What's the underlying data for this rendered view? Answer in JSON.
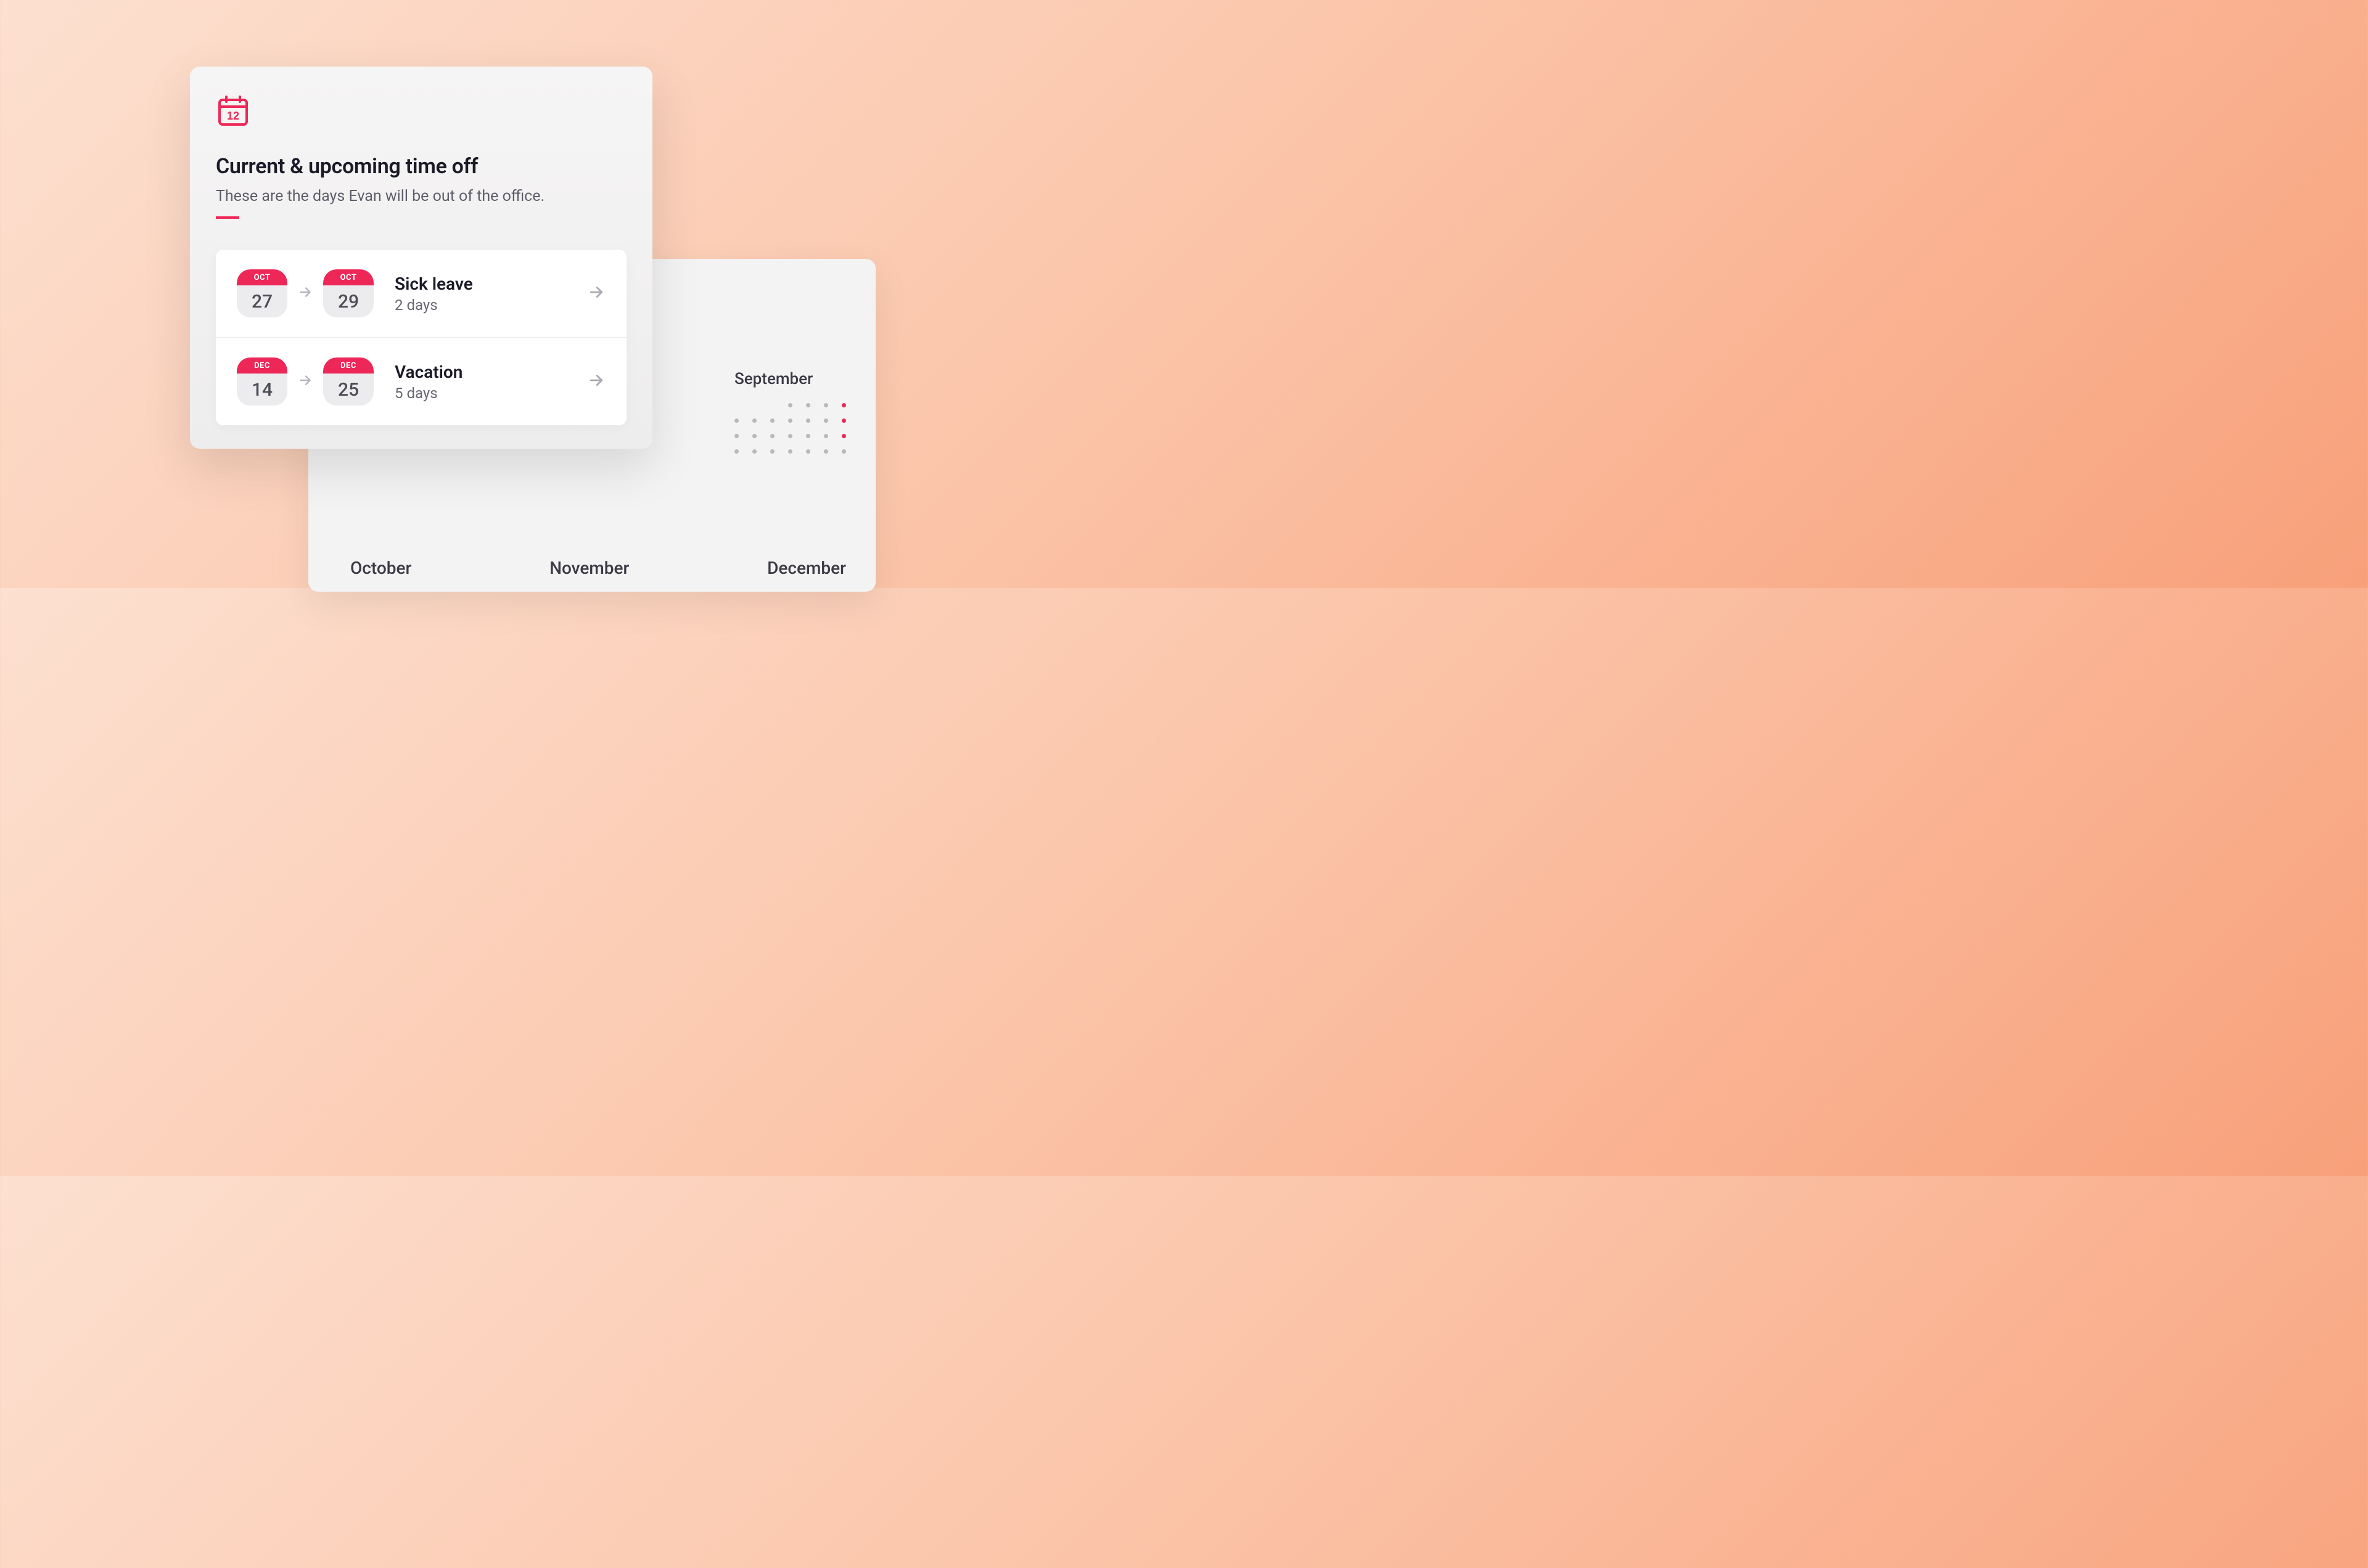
{
  "card": {
    "title": "Current & upcoming time off",
    "subtitle": "These are the days Evan will be out of the office."
  },
  "entries": [
    {
      "start_month": "OCT",
      "start_day": "27",
      "end_month": "OCT",
      "end_day": "29",
      "title": "Sick leave",
      "duration": "2 days"
    },
    {
      "start_month": "DEC",
      "start_day": "14",
      "end_month": "DEC",
      "end_day": "25",
      "title": "Vacation",
      "duration": "5 days"
    }
  ],
  "back_panel": {
    "current_month": "September",
    "nav": [
      "October",
      "November",
      "December"
    ]
  },
  "colors": {
    "accent": "#ed2757"
  }
}
